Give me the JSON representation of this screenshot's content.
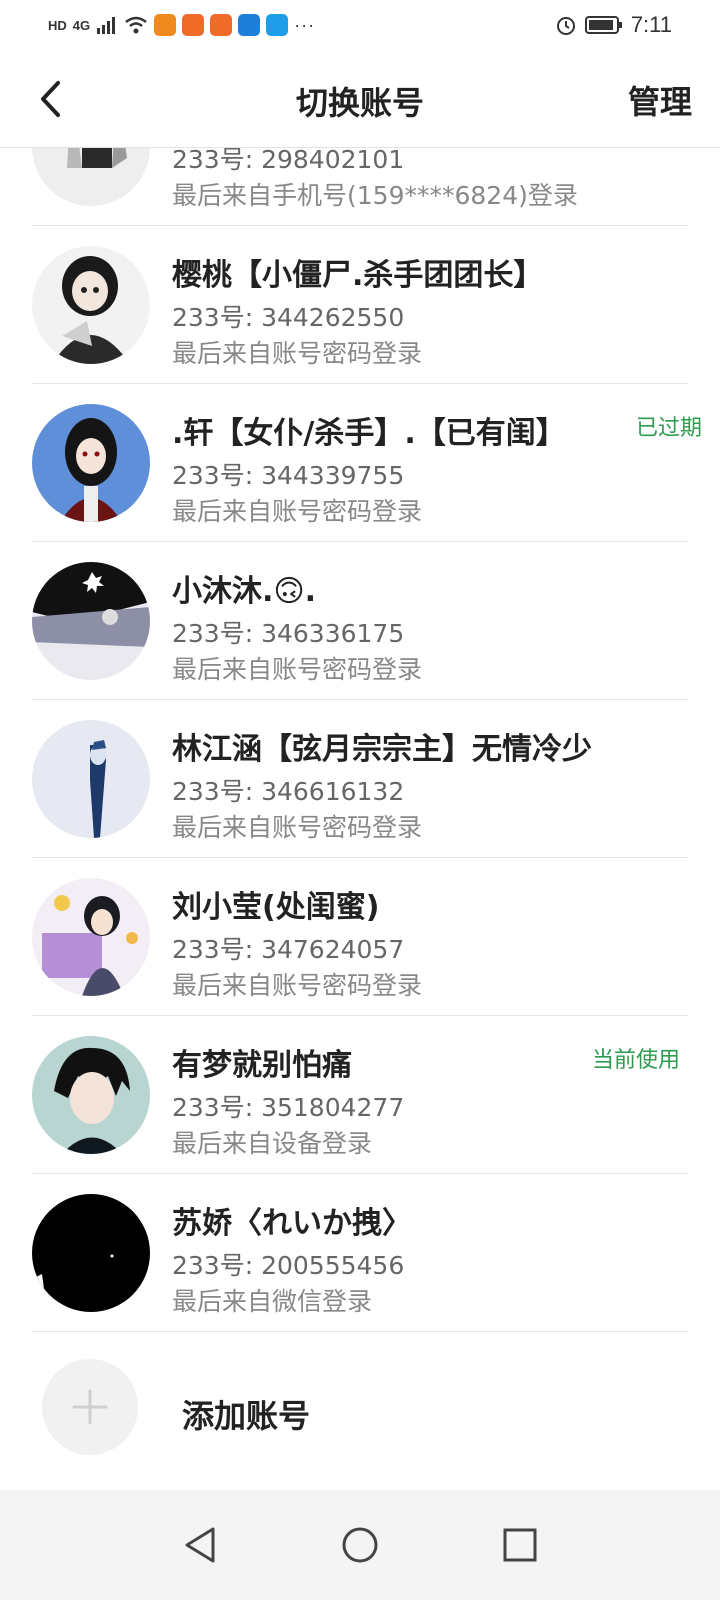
{
  "status_bar": {
    "network_text": "HD",
    "signal_text": "4G",
    "more_text": "···",
    "time": "7:11"
  },
  "header": {
    "title": "切换账号",
    "manage_label": "管理"
  },
  "accounts": [
    {
      "name": "",
      "id_text": "233号: 298402101",
      "login_text": "最后来自手机号(159****6824)登录",
      "tag": ""
    },
    {
      "name": "樱桃【小僵尸.杀手团团长】",
      "id_text": "233号: 344262550",
      "login_text": "最后来自账号密码登录",
      "tag": ""
    },
    {
      "name": ".轩【女仆/杀手】.【已有闺】",
      "id_text": "233号: 344339755",
      "login_text": "最后来自账号密码登录",
      "tag": "已过期"
    },
    {
      "name": "小沐沐.🙃.",
      "id_text": "233号: 346336175",
      "login_text": "最后来自账号密码登录",
      "tag": ""
    },
    {
      "name": "林江涵【弦月宗宗主】无情冷少",
      "id_text": "233号: 346616132",
      "login_text": "最后来自账号密码登录",
      "tag": ""
    },
    {
      "name": "刘小莹(处闺蜜)",
      "id_text": "233号: 347624057",
      "login_text": "最后来自账号密码登录",
      "tag": ""
    },
    {
      "name": "有梦就别怕痛",
      "id_text": "233号: 351804277",
      "login_text": "最后来自设备登录",
      "tag": "当前使用"
    },
    {
      "name": "苏娇〈れいか拽〉",
      "id_text": "233号: 200555456",
      "login_text": "最后来自微信登录",
      "tag": ""
    }
  ],
  "add_account": {
    "plus": "+",
    "label": "添加账号"
  },
  "colors": {
    "accent_green": "#2e9b50",
    "title_text": "#222222",
    "secondary_text": "#888888"
  },
  "icons": {
    "back": "chevron-left-icon",
    "nav_back": "triangle-back-icon",
    "nav_home": "circle-home-icon",
    "nav_recent": "square-recent-icon"
  }
}
